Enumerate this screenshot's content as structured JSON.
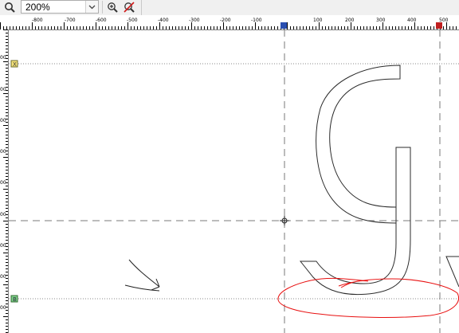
{
  "toolbar": {
    "zoom_value": "200%",
    "icons": [
      "zoom-magnifier-icon",
      "dropdown-chevron-icon",
      "zoom-in-icon",
      "zoom-reset-icon"
    ]
  },
  "ruler_h": {
    "labels": [
      "-800",
      "-700",
      "-600",
      "-500",
      "-400",
      "-300",
      "-200",
      "-100",
      "100",
      "200",
      "300",
      "400",
      "500"
    ]
  },
  "ruler_v": {
    "labels": [
      "00",
      "00",
      "00",
      "00",
      "00",
      "00",
      "00",
      "00",
      "00"
    ]
  },
  "guides": {
    "top_marker": "X",
    "bottom_marker": "B",
    "left_marker": "L",
    "right_marker": "R"
  },
  "colors": {
    "outline": "#2b2b2b",
    "red_annotation": "#e81010",
    "guide": "#7a7a7a"
  }
}
